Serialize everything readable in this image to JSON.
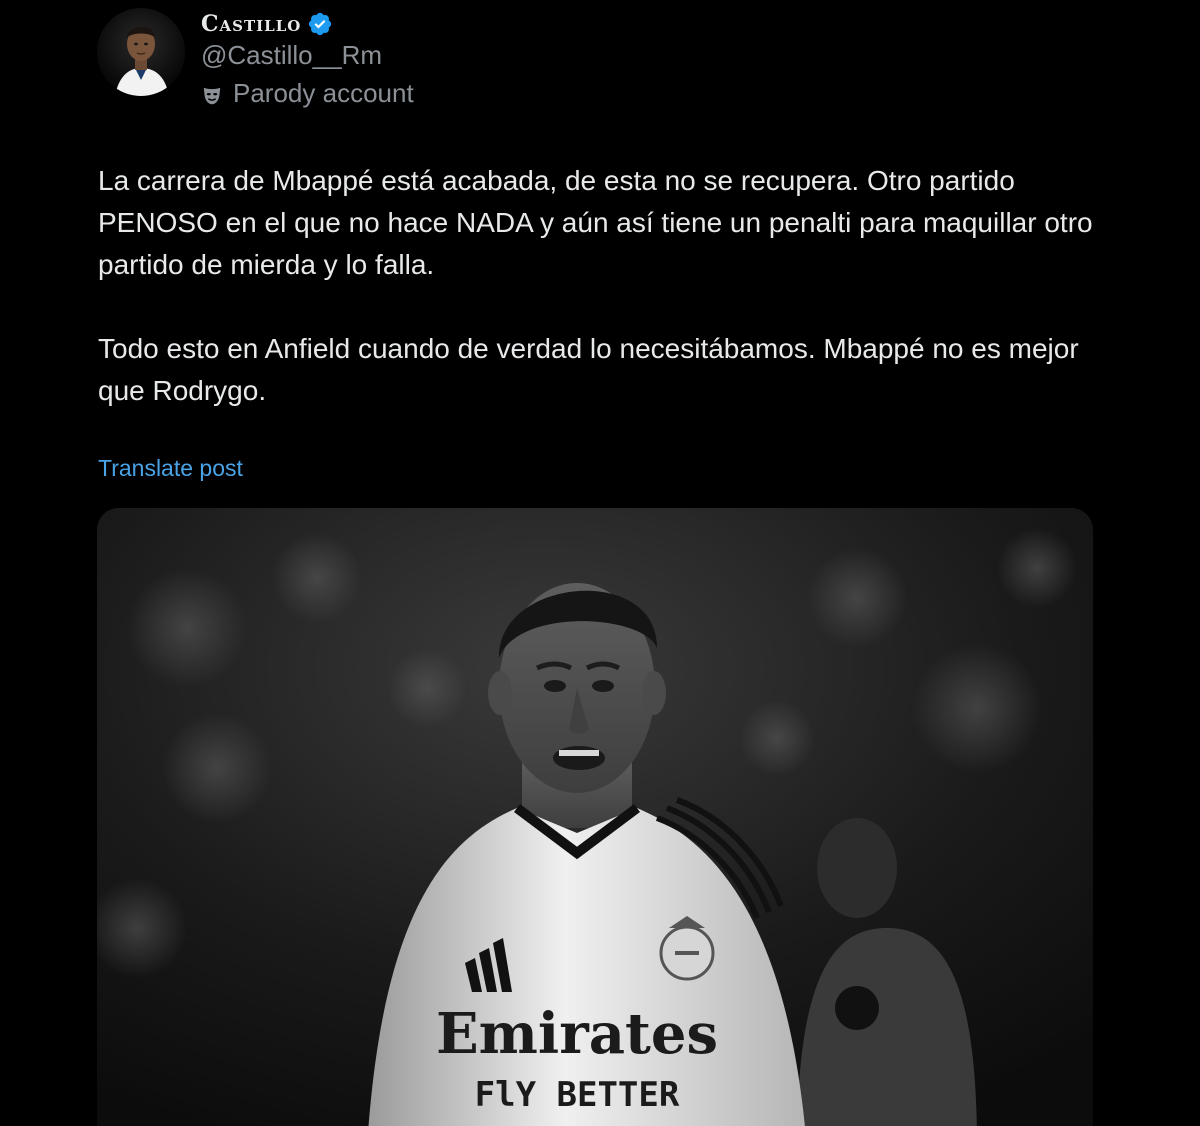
{
  "author": {
    "display_name": "Castillo",
    "handle": "@Castillo__Rm",
    "label": "Parody account",
    "verified": true,
    "verified_color": "#1d9bf0",
    "label_icon": "parody-mask-icon",
    "avatar_icon": "avatar-icon"
  },
  "post": {
    "text": "La carrera de Mbappé está acabada, de esta no se recupera. Otro partido PENOSO en el que no hace NADA y aún así tiene un penalti para maquillar otro partido de mierda y lo falla.\n\nTodo esto en Anfield cuando de verdad lo necesitábamos. Mbappé no es mejor que Rodrygo.",
    "translate_label": "Translate post",
    "translate_color": "#4aa3e6"
  },
  "media": {
    "jersey_sponsor": "Emirates",
    "jersey_tagline": "FlY BETTER"
  },
  "colors": {
    "background": "#000000",
    "text": "#e7e9ea",
    "secondary_text": "#8b9197"
  }
}
